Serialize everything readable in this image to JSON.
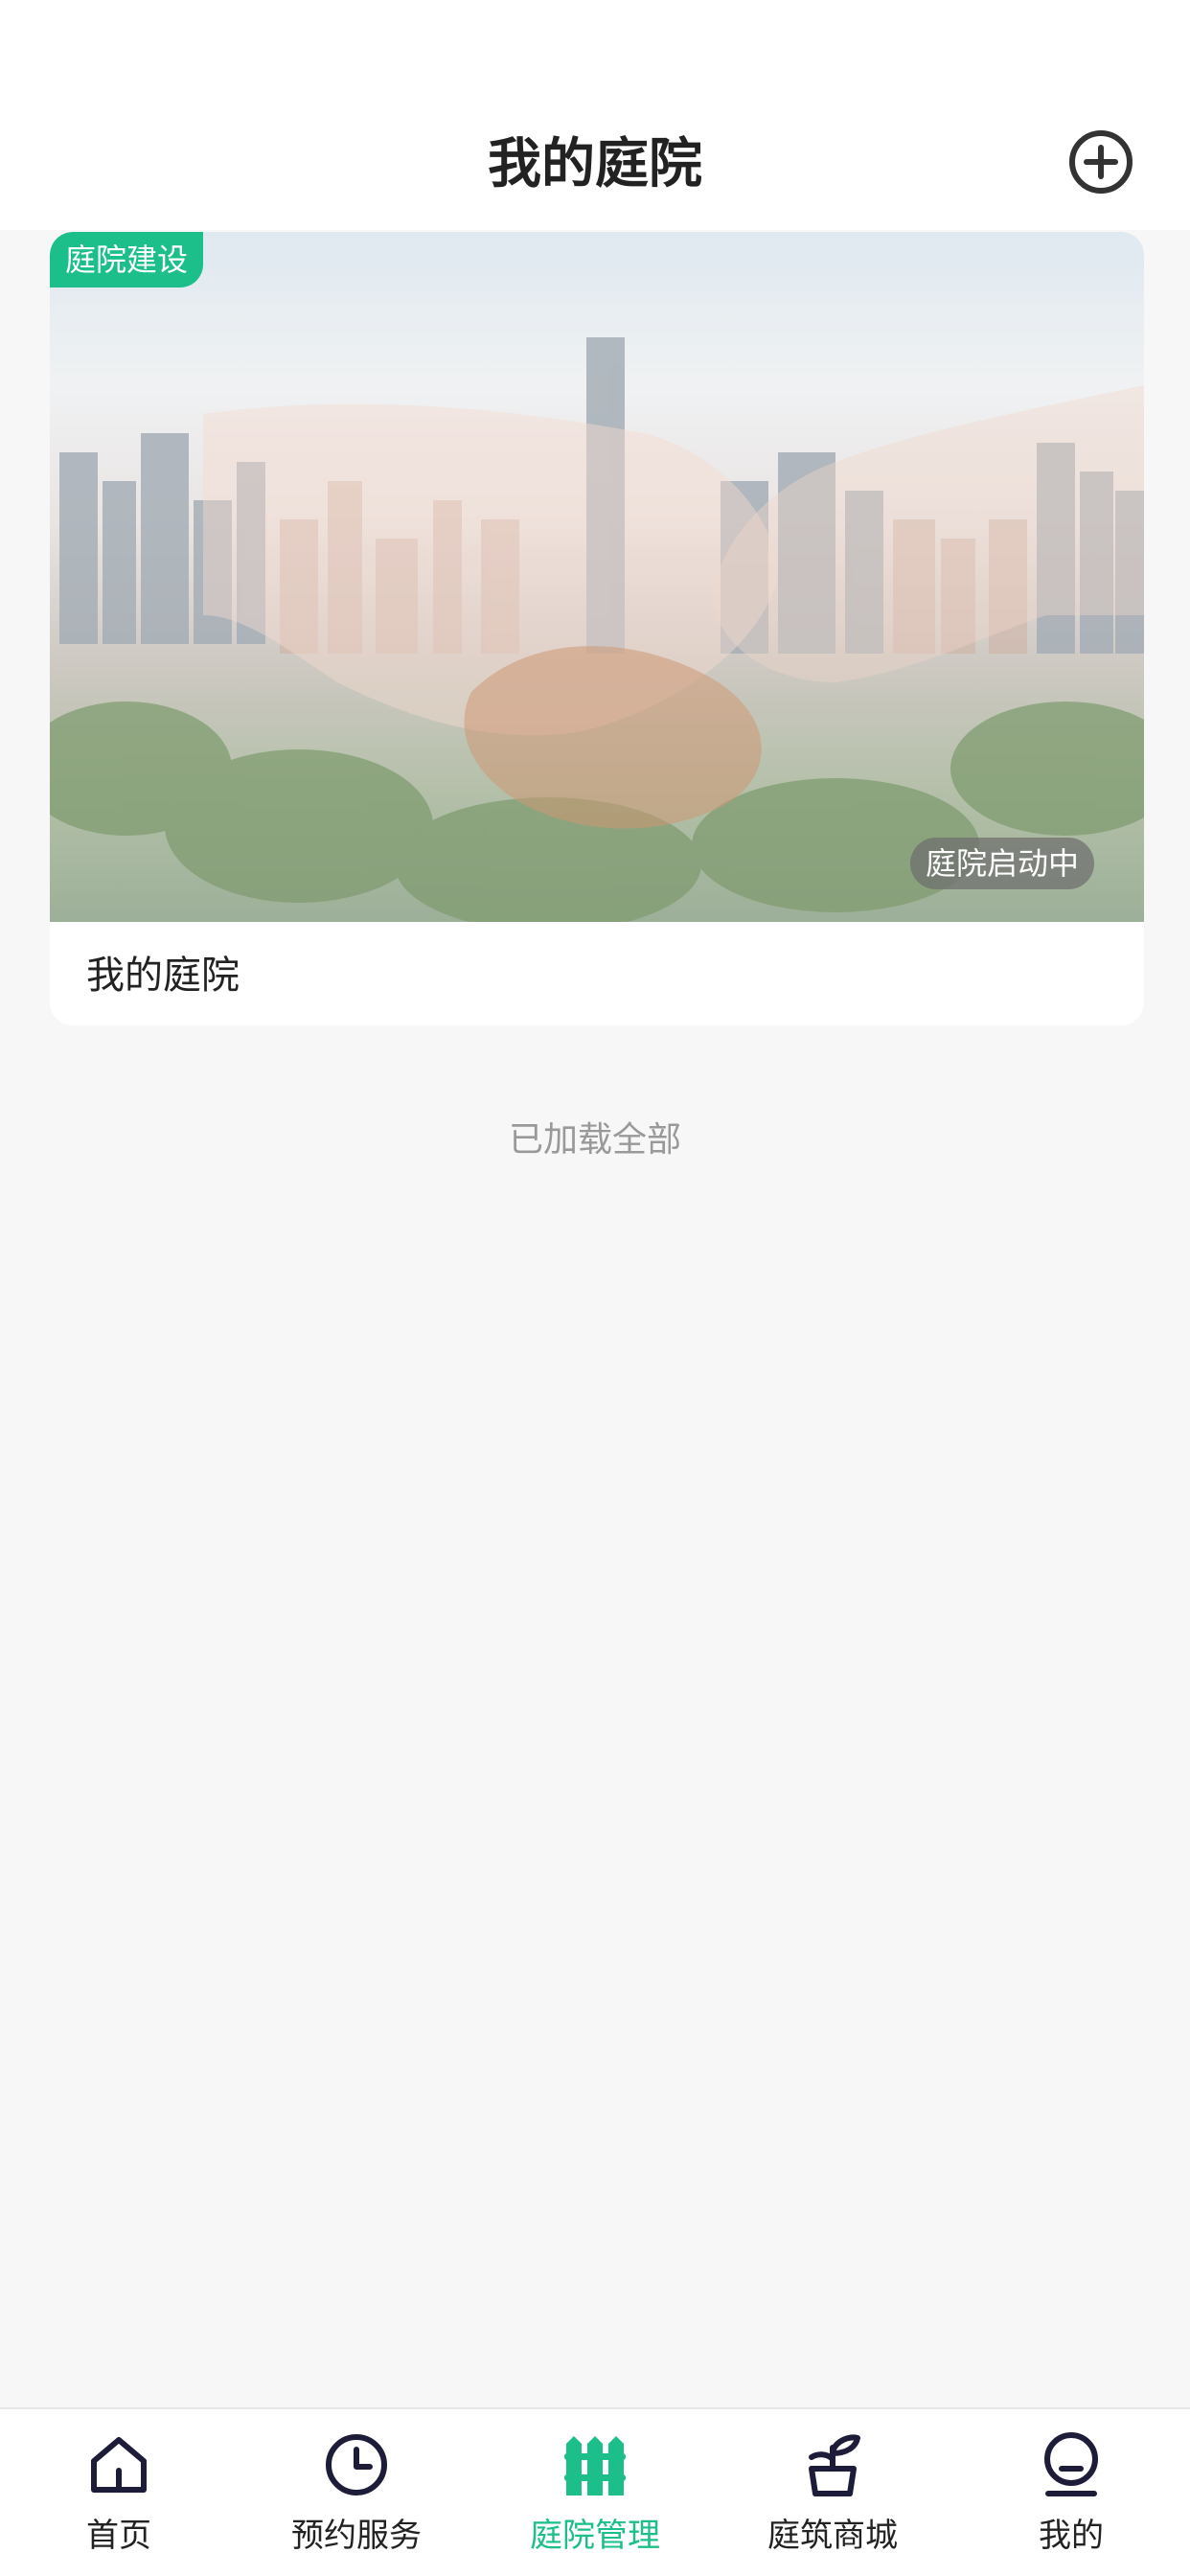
{
  "header": {
    "title": "我的庭院",
    "add_icon": "plus-circle-icon"
  },
  "card": {
    "tag": "庭院建设",
    "status": "庭院启动中",
    "title": "我的庭院",
    "image": "city-handshake-image"
  },
  "list_footer": "已加载全部",
  "tabbar": {
    "active_color": "#1cbf8a",
    "items": [
      {
        "label": "首页",
        "icon": "home-icon"
      },
      {
        "label": "预约服务",
        "icon": "clock-icon"
      },
      {
        "label": "庭院管理",
        "icon": "fence-icon",
        "active": true
      },
      {
        "label": "庭筑商城",
        "icon": "plant-pot-icon"
      },
      {
        "label": "我的",
        "icon": "user-icon"
      }
    ]
  }
}
